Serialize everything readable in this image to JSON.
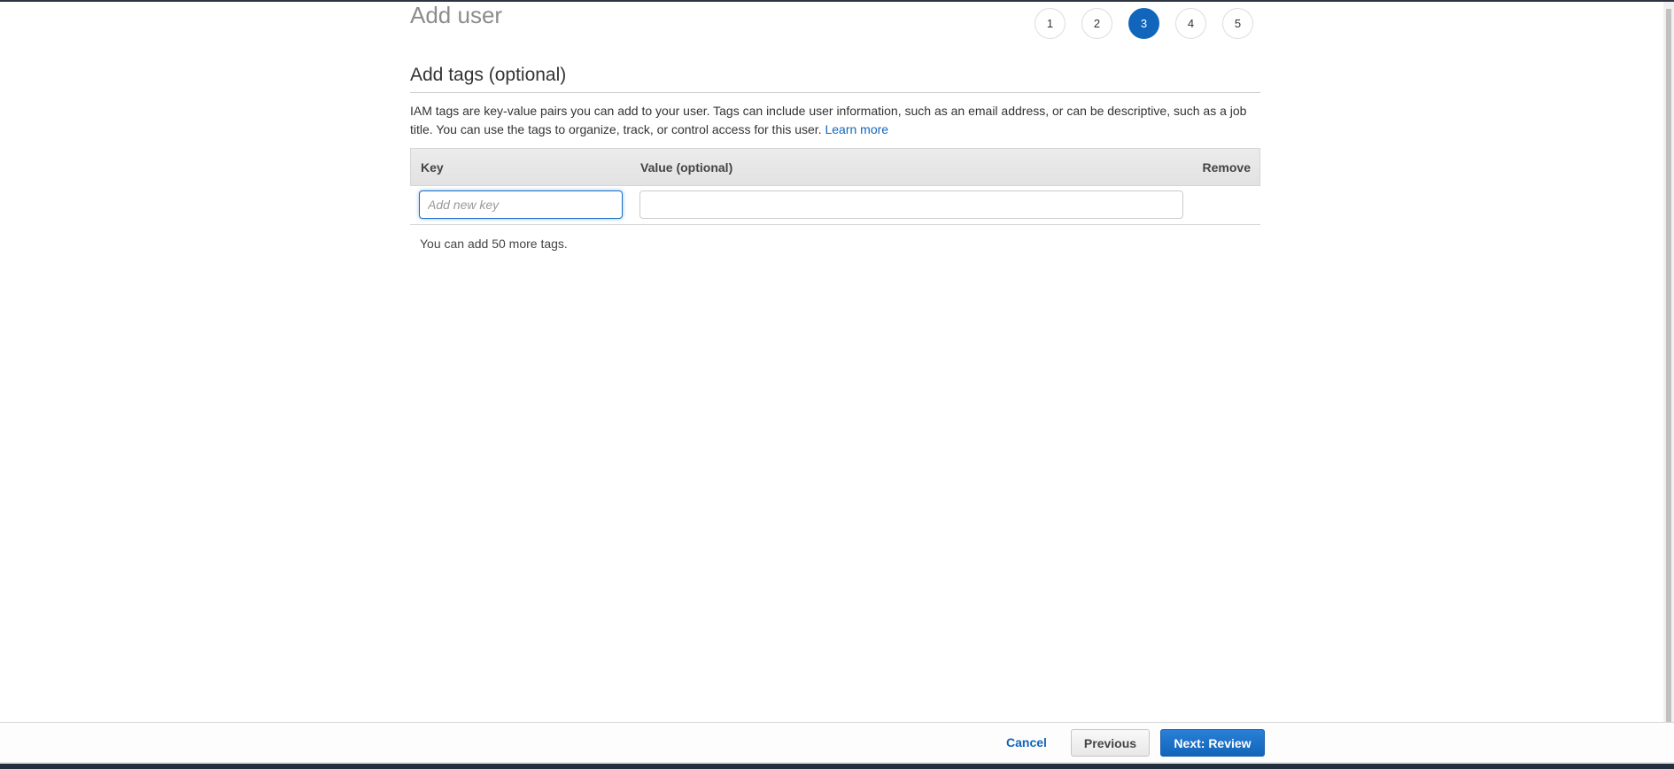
{
  "page": {
    "title": "Add user"
  },
  "wizard": {
    "steps": [
      {
        "label": "1",
        "active": false
      },
      {
        "label": "2",
        "active": false
      },
      {
        "label": "3",
        "active": true
      },
      {
        "label": "4",
        "active": false
      },
      {
        "label": "5",
        "active": false
      }
    ],
    "active_color": "#1166bb"
  },
  "section": {
    "title": "Add tags (optional)",
    "description": "IAM tags are key-value pairs you can add to your user. Tags can include user information, such as an email address, or can be descriptive, such as a job title. You can use the tags to organize, track, or control access for this user.",
    "learn_more_label": "Learn more"
  },
  "tags_table": {
    "columns": {
      "key": "Key",
      "value": "Value (optional)",
      "remove": "Remove"
    },
    "rows": [
      {
        "key_value": "",
        "key_placeholder": "Add new key",
        "value_value": "",
        "value_placeholder": ""
      }
    ],
    "remaining_text": "You can add 50 more tags."
  },
  "footer": {
    "cancel_label": "Cancel",
    "previous_label": "Previous",
    "next_label": "Next: Review"
  },
  "colors": {
    "link": "#1166bb",
    "primary_button": "#1166bb"
  }
}
